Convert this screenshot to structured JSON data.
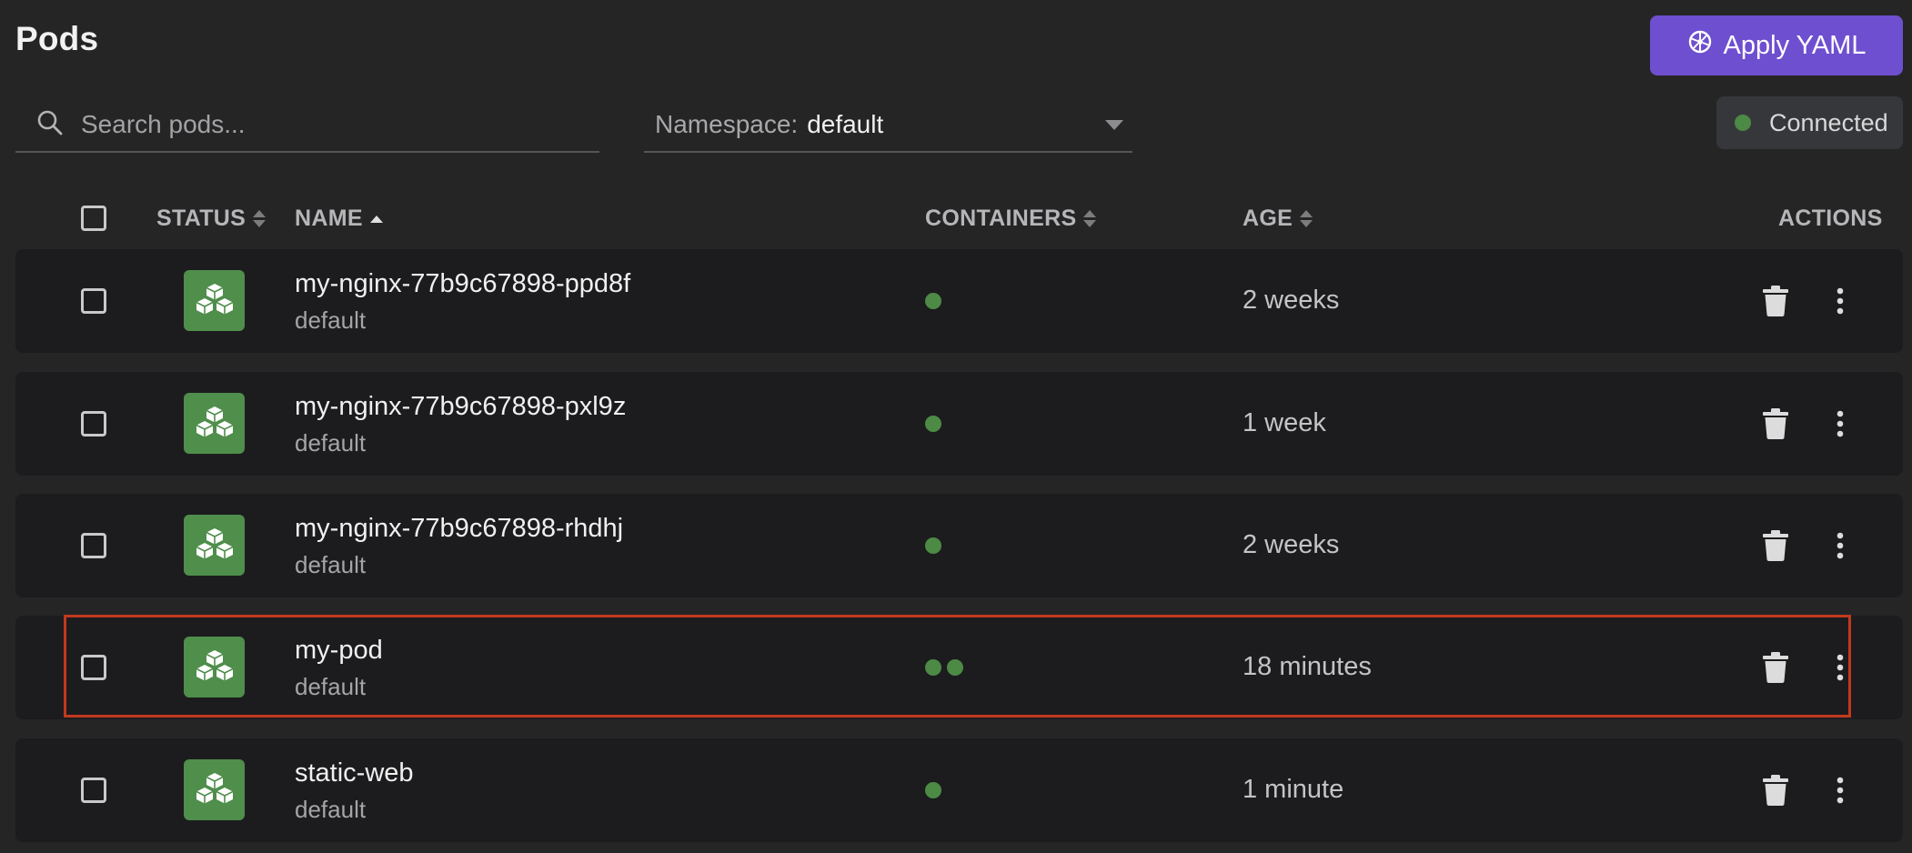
{
  "header": {
    "title": "Pods",
    "apply_button_label": "Apply YAML"
  },
  "search": {
    "placeholder": "Search pods...",
    "value": ""
  },
  "namespace": {
    "label": "Namespace:",
    "value": "default"
  },
  "connection": {
    "label": "Connected",
    "color": "#4c8a45"
  },
  "table": {
    "columns": {
      "status": "STATUS",
      "name": "NAME",
      "containers": "CONTAINERS",
      "age": "AGE",
      "actions": "ACTIONS"
    },
    "sort": {
      "column": "NAME",
      "direction": "ascending"
    },
    "rows": [
      {
        "name": "my-nginx-77b9c67898-ppd8f",
        "namespace": "default",
        "containers": 1,
        "age": "2 weeks",
        "status": "running"
      },
      {
        "name": "my-nginx-77b9c67898-pxl9z",
        "namespace": "default",
        "containers": 1,
        "age": "1 week",
        "status": "running"
      },
      {
        "name": "my-nginx-77b9c67898-rhdhj",
        "namespace": "default",
        "containers": 1,
        "age": "2 weeks",
        "status": "running"
      },
      {
        "name": "my-pod",
        "namespace": "default",
        "containers": 2,
        "age": "18 minutes",
        "status": "running",
        "highlighted": true
      },
      {
        "name": "static-web",
        "namespace": "default",
        "containers": 1,
        "age": "1 minute",
        "status": "running"
      }
    ]
  },
  "colors": {
    "accent": "#6e4fcf",
    "status_running": "#4f8e4b",
    "highlight_border": "#c2391d"
  },
  "icons": {
    "apply": "kubernetes-helm-icon",
    "search": "search-icon",
    "status": "cubes-icon",
    "delete": "trash-icon",
    "more": "more-vertical-icon"
  }
}
